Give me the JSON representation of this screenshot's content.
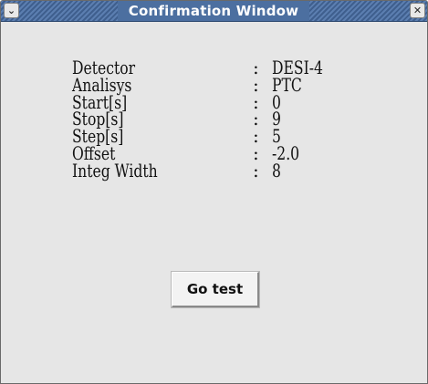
{
  "window": {
    "title": "Confirmation Window",
    "menu_button_glyph": "⌄",
    "close_button_glyph": "✕"
  },
  "details": [
    {
      "label": "Detector",
      "separator": ":",
      "value": "DESI-4"
    },
    {
      "label": "Analisys",
      "separator": ":",
      "value": "PTC"
    },
    {
      "label": "Start[s]",
      "separator": ":",
      "value": "0"
    },
    {
      "label": "Stop[s]",
      "separator": ":",
      "value": "9"
    },
    {
      "label": "Step[s]",
      "separator": ":",
      "value": "5"
    },
    {
      "label": "Offset",
      "separator": ":",
      "value": "-2.0"
    },
    {
      "label": "Integ Width",
      "separator": ":",
      "value": "8"
    }
  ],
  "actions": {
    "go_test_label": "Go test"
  },
  "colors": {
    "titlebar": "#4c6fa0",
    "window_background": "#e6e6e6",
    "button_background": "#f3f3f3"
  },
  "icons": {
    "menu": "chevron-down-icon",
    "close": "close-icon"
  }
}
